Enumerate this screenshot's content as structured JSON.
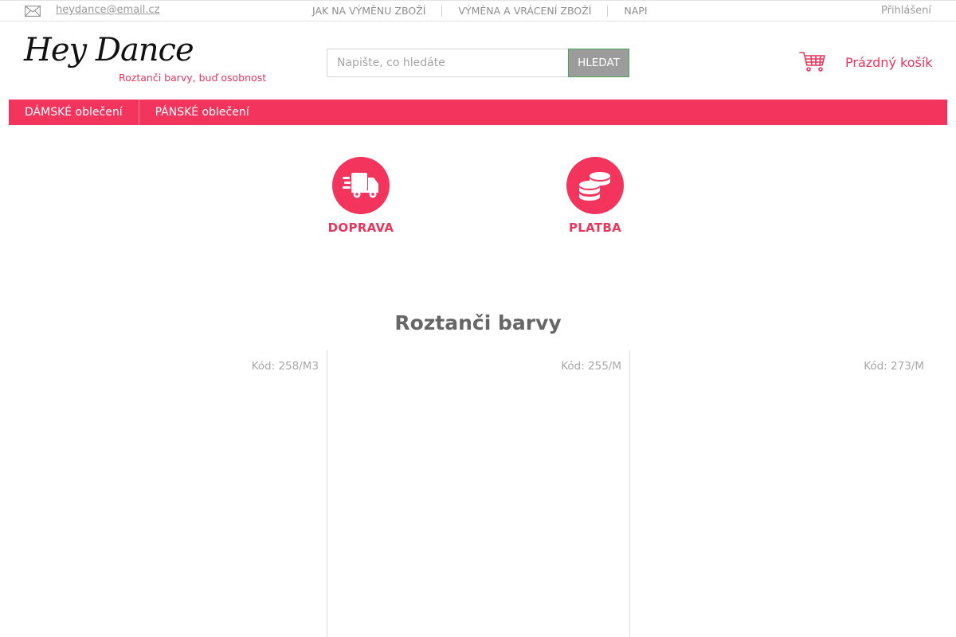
{
  "topbar": {
    "mail_icon": "envelope-icon",
    "email": "heydance@email.cz",
    "links": [
      {
        "label": "JAK NA VÝMĚNU ZBOŽÍ"
      },
      {
        "label": "VÝMĚNA A VRÁCENÍ ZBOŽÍ"
      },
      {
        "label": "NAPI"
      }
    ],
    "login": "Přihlášení"
  },
  "header": {
    "logo_text": "Hey Dance",
    "tagline": "Roztanči barvy, buď osobnost",
    "search": {
      "placeholder": "Napište, co hledáte",
      "value": "",
      "button": "HLEDAT"
    },
    "cart": {
      "icon": "cart-icon",
      "label": "Prázdný košík"
    }
  },
  "nav": {
    "items": [
      {
        "label": "DÁMSKÉ oblečení"
      },
      {
        "label": "PÁNSKÉ oblečení"
      }
    ]
  },
  "info": [
    {
      "icon": "truck-icon",
      "label": "DOPRAVA"
    },
    {
      "icon": "coins-icon",
      "label": "PLATBA"
    }
  ],
  "section": {
    "title": "Roztanči barvy",
    "products": [
      {
        "code": "Kód: 258/M3"
      },
      {
        "code": "Kód: 255/M"
      },
      {
        "code": "Kód: 273/M"
      }
    ]
  },
  "colors": {
    "accent": "#f3345d",
    "accent_text": "#e8365d",
    "search_button": "#9c9c9c"
  }
}
